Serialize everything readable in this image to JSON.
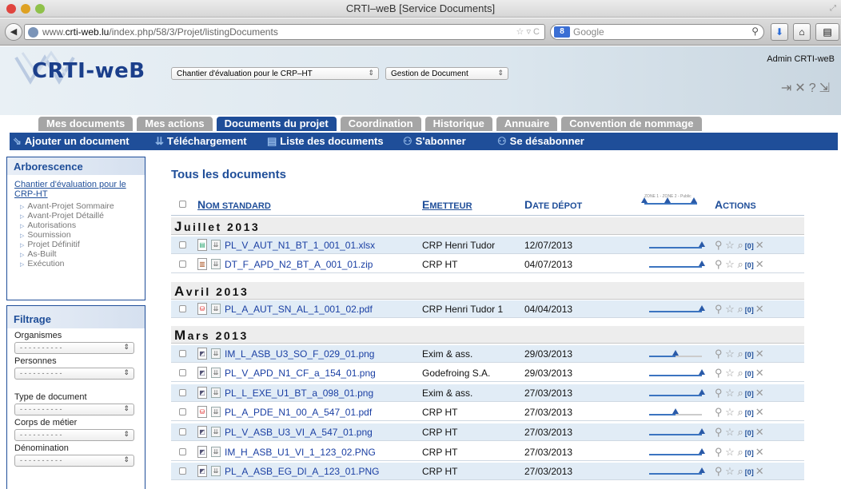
{
  "window": {
    "title": "CRTI–weB [Service Documents]"
  },
  "toolbar": {
    "url_prefix": "www.",
    "url_host": "crti-web.lu",
    "url_path": "/index.php/58/3/Projet/listingDocuments",
    "search_engine": "Google"
  },
  "header": {
    "logo": "CRTI-weB",
    "project_select": "Chantier d'évaluation pour le CRP–HT",
    "module_select": "Gestion de Document",
    "user": "Admin CRTI-weB"
  },
  "tabs": [
    "Mes documents",
    "Mes actions",
    "Documents du projet",
    "Coordination",
    "Historique",
    "Annuaire",
    "Convention de nommage"
  ],
  "actions": {
    "add": "Ajouter un document",
    "download": "Téléchargement",
    "list": "Liste des documents",
    "subscribe": "S'abonner",
    "unsubscribe": "Se désabonner"
  },
  "sidebar": {
    "tree_title": "Arborescence",
    "project_link": "Chantier d'évaluation pour le CRP-HT",
    "phases": [
      "Avant-Projet Sommaire",
      "Avant-Projet Détaillé",
      "Autorisations",
      "Soumission",
      "Projet Définitif",
      "As-Built",
      "Exécution"
    ],
    "filter_title": "Filtrage",
    "filter_placeholder": "- - - - - - - - - -",
    "filters": [
      "Organismes",
      "Personnes",
      "Type de document",
      "Corps de métier",
      "Dénomination"
    ]
  },
  "main": {
    "title": "Tous les documents",
    "col_name_first": "N",
    "col_name_rest": "OM STANDARD",
    "col_emit_first": "E",
    "col_emit_rest": "METTEUR",
    "col_date_first": "D",
    "col_date_rest": "ATE DÉPOT",
    "col_actions_first": "A",
    "col_actions_rest": "CTIONS",
    "zone_scale": "ZONE 1 - ZONE 2 - Public",
    "groups": [
      {
        "initial": "J",
        "rest": "uillet 2013"
      },
      {
        "initial": "A",
        "rest": "vril 2013"
      },
      {
        "initial": "M",
        "rest": "ars 2013"
      }
    ],
    "rows": [
      {
        "name": "PL_V_AUT_N1_BT_1_001_01.xlsx",
        "emitter": "CRP Henri Tudor",
        "date": "12/07/2013",
        "progress": 1.0
      },
      {
        "name": "DT_F_APD_N2_BT_A_001_01.zip",
        "emitter": "CRP HT",
        "date": "04/07/2013",
        "progress": 1.0
      },
      {
        "name": "PL_A_AUT_SN_AL_1_001_02.pdf",
        "emitter": "CRP Henri Tudor 1",
        "date": "04/04/2013",
        "progress": 1.0
      },
      {
        "name": "IM_L_ASB_U3_SO_F_029_01.png",
        "emitter": "Exim & ass.",
        "date": "29/03/2013",
        "progress": 0.5
      },
      {
        "name": "PL_V_APD_N1_CF_a_154_01.png",
        "emitter": "Godefroing S.A.",
        "date": "29/03/2013",
        "progress": 1.0
      },
      {
        "name": "PL_L_EXE_U1_BT_a_098_01.png",
        "emitter": "Exim & ass.",
        "date": "27/03/2013",
        "progress": 1.0
      },
      {
        "name": "PL_A_PDE_N1_00_A_547_01.pdf",
        "emitter": "CRP HT",
        "date": "27/03/2013",
        "progress": 0.5
      },
      {
        "name": "PL_V_ASB_U3_VI_A_547_01.png",
        "emitter": "CRP HT",
        "date": "27/03/2013",
        "progress": 1.0
      },
      {
        "name": "IM_H_ASB_U1_VI_1_123_02.PNG",
        "emitter": "CRP HT",
        "date": "27/03/2013",
        "progress": 1.0
      },
      {
        "name": "PL_A_ASB_EG_DI_A_123_01.PNG",
        "emitter": "CRP HT",
        "date": "27/03/2013",
        "progress": 1.0
      }
    ],
    "zero_label": "[0]"
  }
}
